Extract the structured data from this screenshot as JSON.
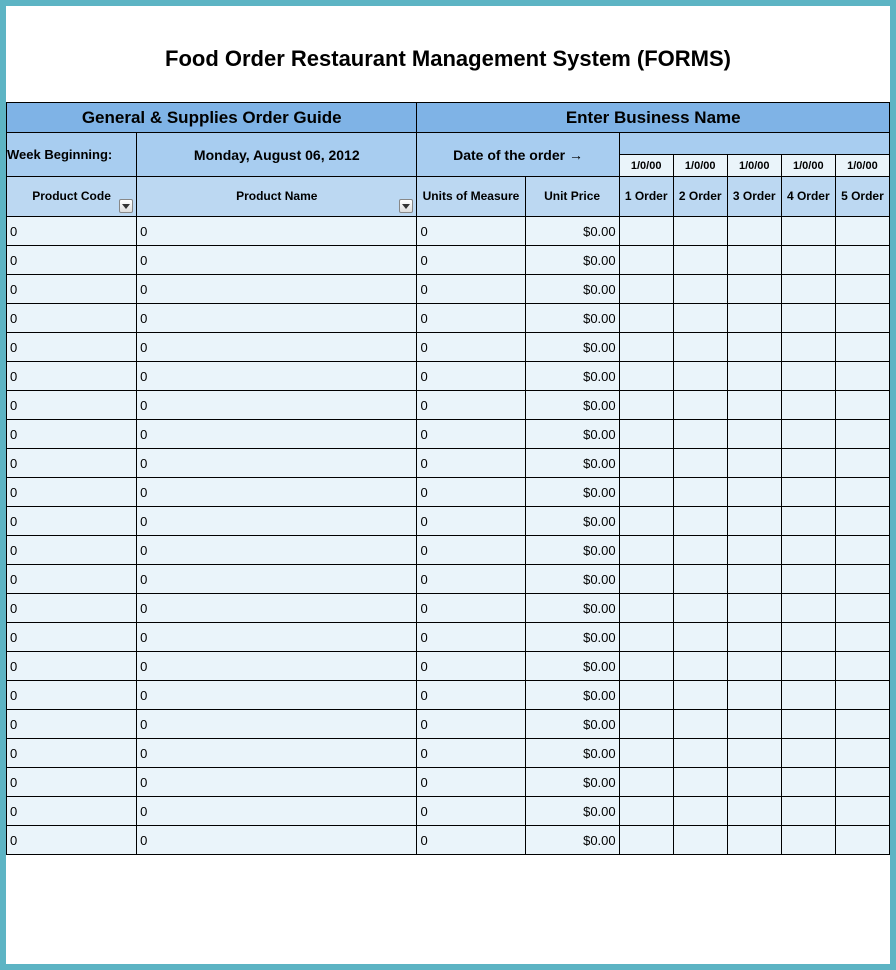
{
  "title": "Food Order Restaurant Management System (FORMS)",
  "left_section_title": "General & Supplies Order Guide",
  "right_section_title": "Enter Business Name",
  "week_beginning_label": "Week Beginning:",
  "week_beginning_value": "Monday, August 06, 2012",
  "date_of_order_label": "Date of the order  →",
  "order_dates": [
    "1/0/00",
    "1/0/00",
    "1/0/00",
    "1/0/00",
    "1/0/00"
  ],
  "columns": {
    "product_code": "Product Code",
    "product_name": "Product Name",
    "units_of_measure": "Units of Measure",
    "unit_price": "Unit Price",
    "order1": "1 Order",
    "order2": "2 Order",
    "order3": "3 Order",
    "order4": "4 Order",
    "order5": "5 Order"
  },
  "rows": [
    {
      "code": "0",
      "name": "0",
      "uom": "0",
      "price": "$0.00",
      "o1": "",
      "o2": "",
      "o3": "",
      "o4": "",
      "o5": ""
    },
    {
      "code": "0",
      "name": "0",
      "uom": "0",
      "price": "$0.00",
      "o1": "",
      "o2": "",
      "o3": "",
      "o4": "",
      "o5": ""
    },
    {
      "code": "0",
      "name": "0",
      "uom": "0",
      "price": "$0.00",
      "o1": "",
      "o2": "",
      "o3": "",
      "o4": "",
      "o5": ""
    },
    {
      "code": "0",
      "name": "0",
      "uom": "0",
      "price": "$0.00",
      "o1": "",
      "o2": "",
      "o3": "",
      "o4": "",
      "o5": ""
    },
    {
      "code": "0",
      "name": "0",
      "uom": "0",
      "price": "$0.00",
      "o1": "",
      "o2": "",
      "o3": "",
      "o4": "",
      "o5": ""
    },
    {
      "code": "0",
      "name": "0",
      "uom": "0",
      "price": "$0.00",
      "o1": "",
      "o2": "",
      "o3": "",
      "o4": "",
      "o5": ""
    },
    {
      "code": "0",
      "name": "0",
      "uom": "0",
      "price": "$0.00",
      "o1": "",
      "o2": "",
      "o3": "",
      "o4": "",
      "o5": ""
    },
    {
      "code": "0",
      "name": "0",
      "uom": "0",
      "price": "$0.00",
      "o1": "",
      "o2": "",
      "o3": "",
      "o4": "",
      "o5": ""
    },
    {
      "code": "0",
      "name": "0",
      "uom": "0",
      "price": "$0.00",
      "o1": "",
      "o2": "",
      "o3": "",
      "o4": "",
      "o5": ""
    },
    {
      "code": "0",
      "name": "0",
      "uom": "0",
      "price": "$0.00",
      "o1": "",
      "o2": "",
      "o3": "",
      "o4": "",
      "o5": ""
    },
    {
      "code": "0",
      "name": "0",
      "uom": "0",
      "price": "$0.00",
      "o1": "",
      "o2": "",
      "o3": "",
      "o4": "",
      "o5": ""
    },
    {
      "code": "0",
      "name": "0",
      "uom": "0",
      "price": "$0.00",
      "o1": "",
      "o2": "",
      "o3": "",
      "o4": "",
      "o5": ""
    },
    {
      "code": "0",
      "name": "0",
      "uom": "0",
      "price": "$0.00",
      "o1": "",
      "o2": "",
      "o3": "",
      "o4": "",
      "o5": ""
    },
    {
      "code": "0",
      "name": "0",
      "uom": "0",
      "price": "$0.00",
      "o1": "",
      "o2": "",
      "o3": "",
      "o4": "",
      "o5": ""
    },
    {
      "code": "0",
      "name": "0",
      "uom": "0",
      "price": "$0.00",
      "o1": "",
      "o2": "",
      "o3": "",
      "o4": "",
      "o5": ""
    },
    {
      "code": "0",
      "name": "0",
      "uom": "0",
      "price": "$0.00",
      "o1": "",
      "o2": "",
      "o3": "",
      "o4": "",
      "o5": ""
    },
    {
      "code": "0",
      "name": "0",
      "uom": "0",
      "price": "$0.00",
      "o1": "",
      "o2": "",
      "o3": "",
      "o4": "",
      "o5": ""
    },
    {
      "code": "0",
      "name": "0",
      "uom": "0",
      "price": "$0.00",
      "o1": "",
      "o2": "",
      "o3": "",
      "o4": "",
      "o5": ""
    },
    {
      "code": "0",
      "name": "0",
      "uom": "0",
      "price": "$0.00",
      "o1": "",
      "o2": "",
      "o3": "",
      "o4": "",
      "o5": ""
    },
    {
      "code": "0",
      "name": "0",
      "uom": "0",
      "price": "$0.00",
      "o1": "",
      "o2": "",
      "o3": "",
      "o4": "",
      "o5": ""
    },
    {
      "code": "0",
      "name": "0",
      "uom": "0",
      "price": "$0.00",
      "o1": "",
      "o2": "",
      "o3": "",
      "o4": "",
      "o5": ""
    },
    {
      "code": "0",
      "name": "0",
      "uom": "0",
      "price": "$0.00",
      "o1": "",
      "o2": "",
      "o3": "",
      "o4": "",
      "o5": ""
    }
  ]
}
